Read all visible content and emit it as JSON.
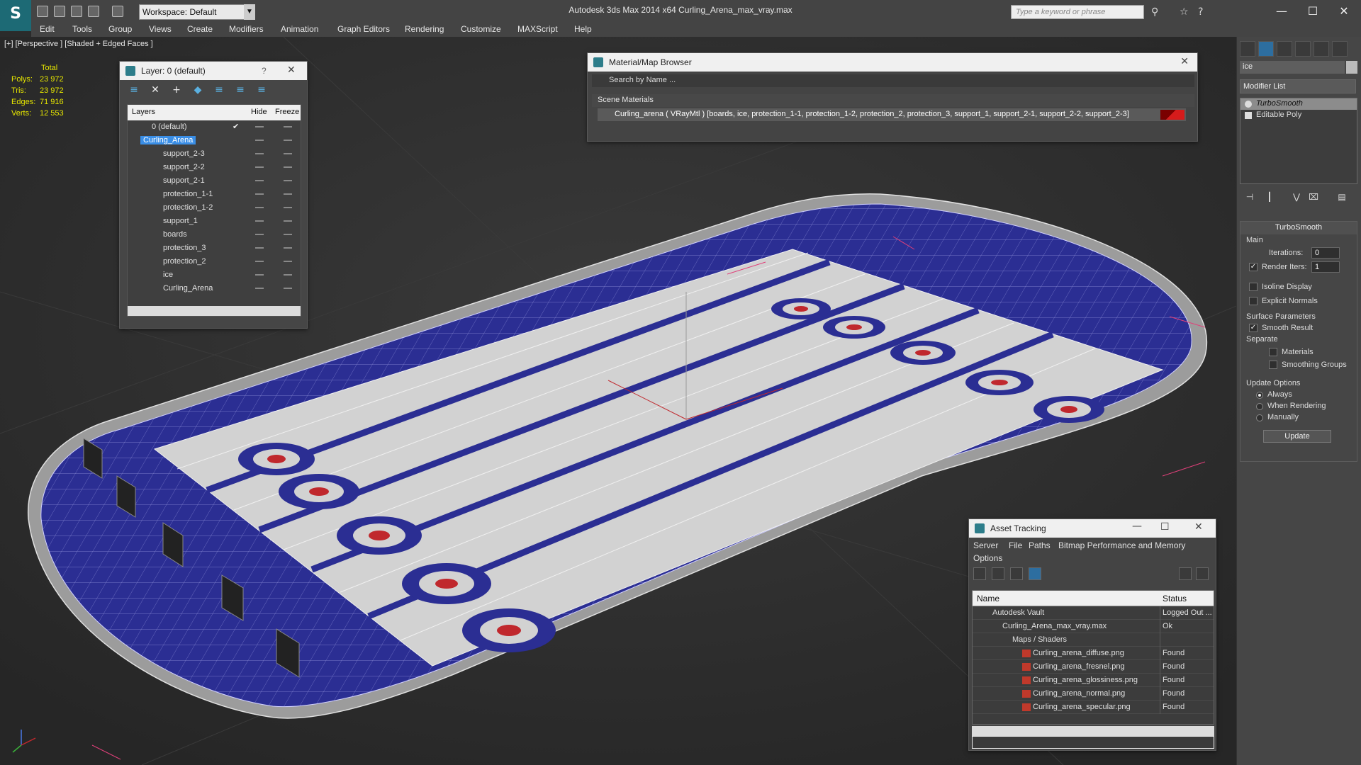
{
  "app": {
    "title": "Autodesk 3ds Max  2014 x64      Curling_Arena_max_vray.max",
    "workspace": "Workspace: Default",
    "search_placeholder": "Type a keyword or phrase"
  },
  "menu": [
    "Edit",
    "Tools",
    "Group",
    "Views",
    "Create",
    "Modifiers",
    "Animation",
    "Graph Editors",
    "Rendering",
    "Customize",
    "MAXScript",
    "Help"
  ],
  "viewport": {
    "label": "[+] [Perspective ] [Shaded + Edged Faces ]",
    "stats": {
      "total_label": "Total",
      "rows": [
        {
          "label": "Polys:",
          "value": "23 972"
        },
        {
          "label": "Tris:",
          "value": "23 972"
        },
        {
          "label": "Edges:",
          "value": "71 916"
        },
        {
          "label": "Verts:",
          "value": "12 553"
        }
      ]
    }
  },
  "layer_window": {
    "title": "Layer: 0 (default)",
    "help": "?",
    "headers": {
      "layers": "Layers",
      "hide": "Hide",
      "freeze": "Freeze"
    },
    "rows": [
      {
        "name": "0 (default)",
        "indent": 1
      },
      {
        "name": "Curling_Arena",
        "indent": 1,
        "selected": true
      },
      {
        "name": "support_2-3",
        "indent": 2
      },
      {
        "name": "support_2-2",
        "indent": 2
      },
      {
        "name": "support_2-1",
        "indent": 2
      },
      {
        "name": "protection_1-1",
        "indent": 2
      },
      {
        "name": "protection_1-2",
        "indent": 2
      },
      {
        "name": "support_1",
        "indent": 2
      },
      {
        "name": "boards",
        "indent": 2
      },
      {
        "name": "protection_3",
        "indent": 2
      },
      {
        "name": "protection_2",
        "indent": 2
      },
      {
        "name": "ice",
        "indent": 2
      },
      {
        "name": "Curling_Arena",
        "indent": 2
      }
    ]
  },
  "material_browser": {
    "title": "Material/Map Browser",
    "search_placeholder": "Search by Name ...",
    "section": "Scene Materials",
    "row": "Curling_arena  ( VRayMtl ) [boards, ice, protection_1-1, protection_1-2, protection_2, protection_3, support_1, support_2-1, support_2-2, support_2-3]"
  },
  "command_panel": {
    "object_name": "ice",
    "modifier_list": "Modifier List",
    "stack": [
      {
        "label": "TurboSmooth",
        "active": true
      },
      {
        "label": "Editable Poly",
        "active": false
      }
    ],
    "rollout_title": "TurboSmooth",
    "main_label": "Main",
    "iterations_label": "Iterations:",
    "iterations_value": "0",
    "render_iters_label": "Render Iters:",
    "render_iters_value": "1",
    "isoline_label": "Isoline Display",
    "explicit_normals_label": "Explicit Normals",
    "surface_params_label": "Surface Parameters",
    "smooth_result_label": "Smooth Result",
    "separate_label": "Separate",
    "materials_label": "Materials",
    "smoothing_groups_label": "Smoothing Groups",
    "update_options_label": "Update Options",
    "always_label": "Always",
    "when_rendering_label": "When Rendering",
    "manually_label": "Manually",
    "update_button": "Update"
  },
  "asset_tracking": {
    "title": "Asset Tracking",
    "menu": [
      "Server",
      "File",
      "Paths",
      "Bitmap Performance and Memory",
      "Options"
    ],
    "headers": {
      "name": "Name",
      "status": "Status"
    },
    "rows": [
      {
        "name": "Autodesk Vault",
        "status": "Logged Out ...",
        "indent": 1
      },
      {
        "name": "Curling_Arena_max_vray.max",
        "status": "Ok",
        "indent": 2
      },
      {
        "name": "Maps / Shaders",
        "status": "",
        "indent": 3
      },
      {
        "name": "Curling_arena_diffuse.png",
        "status": "Found",
        "indent": 4
      },
      {
        "name": "Curling_arena_fresnel.png",
        "status": "Found",
        "indent": 4
      },
      {
        "name": "Curling_arena_glossiness.png",
        "status": "Found",
        "indent": 4
      },
      {
        "name": "Curling_arena_normal.png",
        "status": "Found",
        "indent": 4
      },
      {
        "name": "Curling_arena_specular.png",
        "status": "Found",
        "indent": 4
      }
    ]
  },
  "colors": {
    "rink_blue": "#2b2e93",
    "ice_white": "#d9d9d9",
    "house_red": "#c0282d",
    "selection_blue": "#3a8ee6",
    "stats_yellow": "#e6e600"
  }
}
